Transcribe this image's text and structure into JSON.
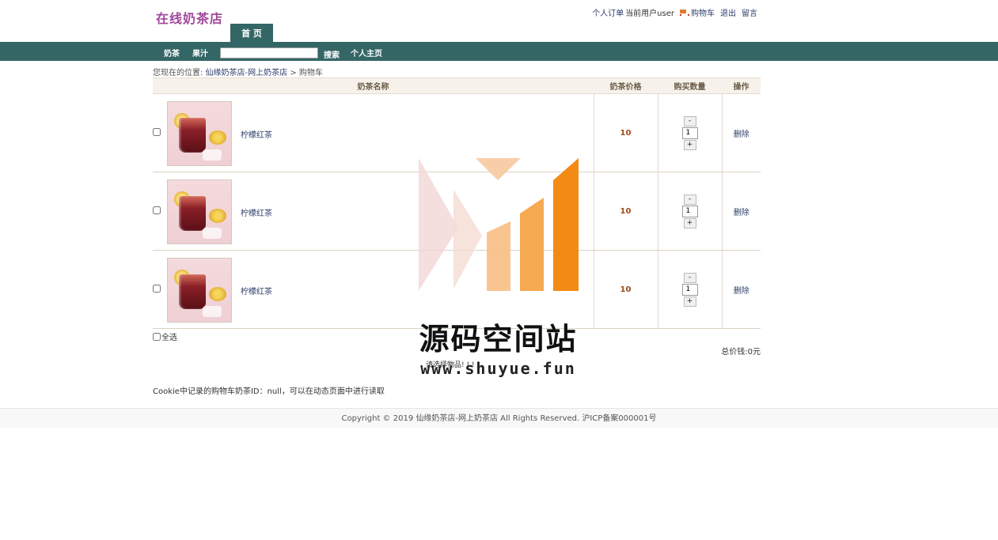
{
  "header": {
    "logo": "在线奶茶店",
    "links": {
      "orders": "个人订单",
      "current_user": "当前用户user",
      "cart": "购物车",
      "logout": "退出",
      "message": "留言"
    },
    "home_tab": "首 页"
  },
  "nav": {
    "milk_tea": "奶茶",
    "juice": "果汁",
    "search_value": "",
    "search_button": "搜索",
    "personal_home": "个人主页"
  },
  "breadcrumb": {
    "prefix": "您现在的位置:",
    "shop": "仙缘奶茶店-网上奶茶店",
    "separator": " > ",
    "current": "购物车"
  },
  "table": {
    "headers": {
      "name": "奶茶名称",
      "price": "奶茶价格",
      "qty": "购买数量",
      "op": "操作"
    },
    "rows": [
      {
        "name": "柠檬红茶",
        "price": "10",
        "qty": "1",
        "minus": "-",
        "plus": "+",
        "delete": "删除"
      },
      {
        "name": "柠檬红茶",
        "price": "10",
        "qty": "1",
        "minus": "-",
        "plus": "+",
        "delete": "删除"
      },
      {
        "name": "柠檬红茶",
        "price": "10",
        "qty": "1",
        "minus": "-",
        "plus": "+",
        "delete": "删除"
      }
    ]
  },
  "select_all": "全选",
  "total": "总价钱:0元",
  "hint": "请选择物品! ! !",
  "cookie_note": "Cookie中记录的购物车奶茶ID：null，可以在动态页面中进行读取",
  "footer": "Copyright © 2019 仙缘奶茶店-网上奶茶店 All Rights Reserved. 沪ICP备案000001号",
  "watermark": {
    "title": "源码空间站",
    "url": "www.shuyue.fun"
  },
  "colors": {
    "nav_bg": "#356666",
    "logo": "#a0489b",
    "price": "#a24a18",
    "link": "#2d3e6b"
  }
}
